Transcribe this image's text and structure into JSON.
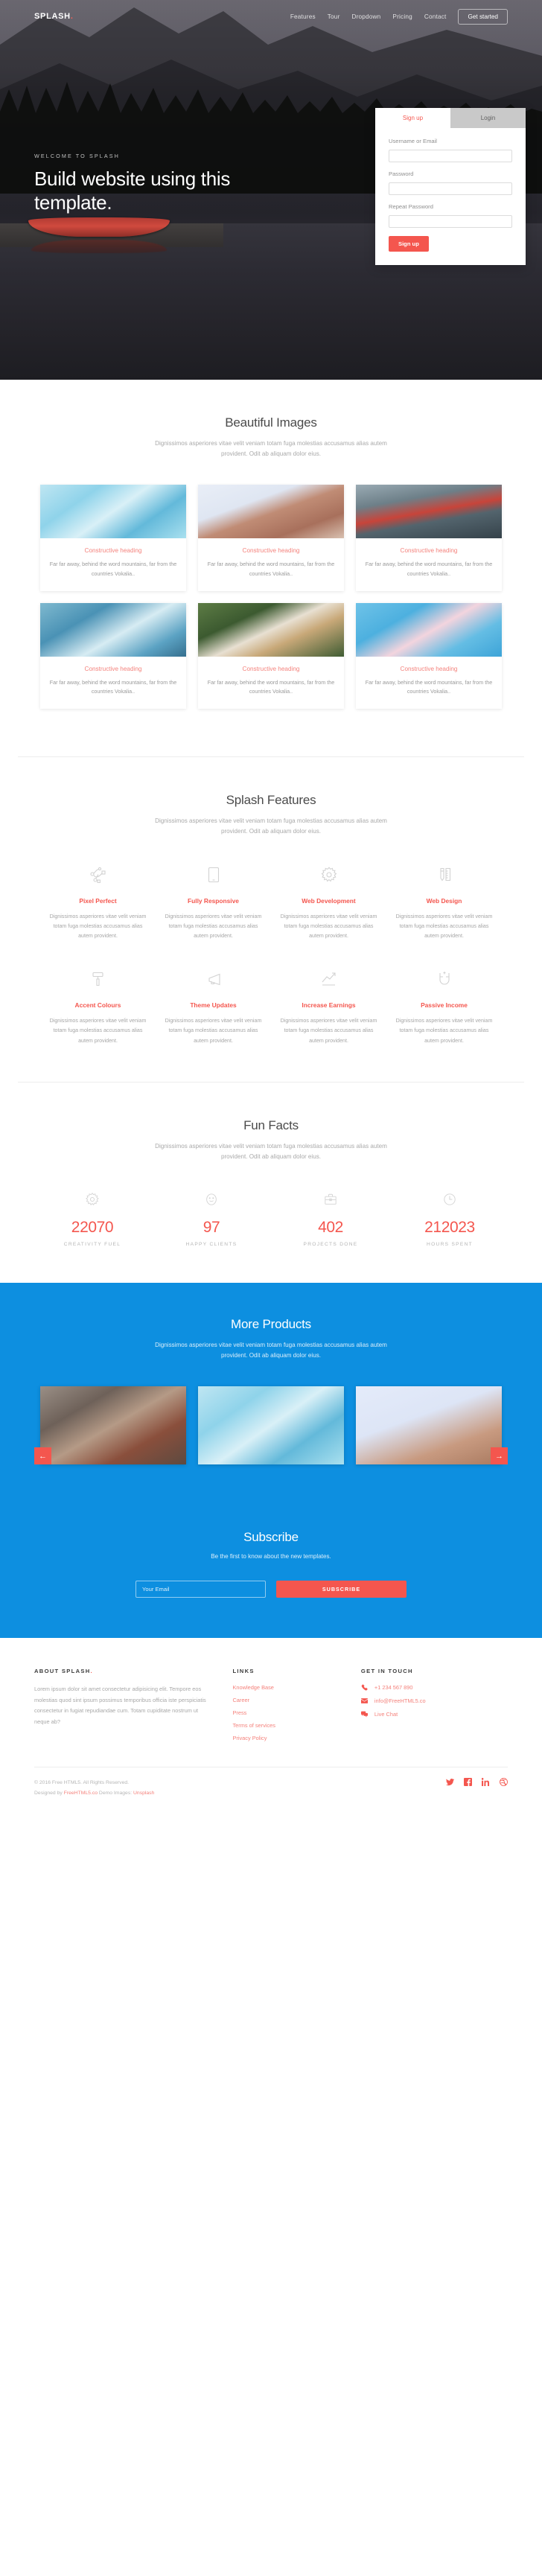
{
  "nav": {
    "brand": "SPLASH",
    "brand_dot": ".",
    "links": [
      {
        "label": "Features"
      },
      {
        "label": "Tour"
      },
      {
        "label": "Dropdown"
      },
      {
        "label": "Pricing"
      },
      {
        "label": "Contact"
      }
    ],
    "cta": "Get started"
  },
  "hero": {
    "eyebrow": "WELCOME TO SPLASH",
    "title": "Build website using this template."
  },
  "signup": {
    "tab_signup": "Sign up",
    "tab_login": "Login",
    "label_username": "Username or Email",
    "label_password": "Password",
    "label_repeat": "Repeat Password",
    "value_username": "",
    "value_password": "",
    "value_repeat": "",
    "button": "Sign up"
  },
  "images_section": {
    "title": "Beautiful Images",
    "subtitle": "Dignissimos asperiores vitae velit veniam totam fuga molestias accusamus alias autem provident. Odit ab aliquam dolor eius.",
    "cards": [
      {
        "heading": "Constructive heading",
        "text": "Far far away, behind the word mountains, far from the countries Vokalia..",
        "photo": "ph-swim"
      },
      {
        "heading": "Constructive heading",
        "text": "Far far away, behind the word mountains, far from the countries Vokalia..",
        "photo": "ph-bldg"
      },
      {
        "heading": "Constructive heading",
        "text": "Far far away, behind the word mountains, far from the countries Vokalia..",
        "photo": "ph-canoe"
      },
      {
        "heading": "Constructive heading",
        "text": "Far far away, behind the word mountains, far from the countries Vokalia..",
        "photo": "ph-water"
      },
      {
        "heading": "Constructive heading",
        "text": "Far far away, behind the word mountains, far from the countries Vokalia..",
        "photo": "ph-flow"
      },
      {
        "heading": "Constructive heading",
        "text": "Far far away, behind the word mountains, far from the countries Vokalia..",
        "photo": "ph-blos"
      }
    ]
  },
  "features_section": {
    "title": "Splash Features",
    "subtitle": "Dignissimos asperiores vitae velit veniam totam fuga molestias accusamus alias autem provident. Odit ab aliquam dolor eius.",
    "items": [
      {
        "icon": "node-graph-icon",
        "title": "Pixel Perfect",
        "text": "Dignissimos asperiores vitae velit veniam totam fuga molestias accusamus alias autem provident."
      },
      {
        "icon": "tablet-icon",
        "title": "Fully Responsive",
        "text": "Dignissimos asperiores vitae velit veniam totam fuga molestias accusamus alias autem provident."
      },
      {
        "icon": "gear-icon",
        "title": "Web Development",
        "text": "Dignissimos asperiores vitae velit veniam totam fuga molestias accusamus alias autem provident."
      },
      {
        "icon": "pencil-ruler-icon",
        "title": "Web Design",
        "text": "Dignissimos asperiores vitae velit veniam totam fuga molestias accusamus alias autem provident."
      },
      {
        "icon": "paint-roller-icon",
        "title": "Accent Colours",
        "text": "Dignissimos asperiores vitae velit veniam totam fuga molestias accusamus alias autem provident."
      },
      {
        "icon": "megaphone-icon",
        "title": "Theme Updates",
        "text": "Dignissimos asperiores vitae velit veniam totam fuga molestias accusamus alias autem provident."
      },
      {
        "icon": "trend-up-icon",
        "title": "Increase Earnings",
        "text": "Dignissimos asperiores vitae velit veniam totam fuga molestias accusamus alias autem provident."
      },
      {
        "icon": "magnet-icon",
        "title": "Passive Income",
        "text": "Dignissimos asperiores vitae velit veniam totam fuga molestias accusamus alias autem provident."
      }
    ]
  },
  "facts_section": {
    "title": "Fun Facts",
    "subtitle": "Dignissimos asperiores vitae velit veniam totam fuga molestias accusamus alias autem provident. Odit ab aliquam dolor eius.",
    "items": [
      {
        "icon": "gear-icon",
        "number": "22070",
        "label": "CREATIVITY FUEL"
      },
      {
        "icon": "smiley-icon",
        "number": "97",
        "label": "HAPPY CLIENTS"
      },
      {
        "icon": "briefcase-icon",
        "number": "402",
        "label": "PROJECTS DONE"
      },
      {
        "icon": "clock-icon",
        "number": "212023",
        "label": "HOURS SPENT"
      }
    ]
  },
  "products_section": {
    "title": "More Products",
    "subtitle": "Dignissimos asperiores vitae velit veniam totam fuga molestias accusamus alias autem provident. Odit ab aliquam dolor eius.",
    "slides": [
      {
        "photo": "ph-rock"
      },
      {
        "photo": "ph-swim"
      },
      {
        "photo": "ph-light"
      }
    ],
    "prev": "←",
    "next": "→"
  },
  "subscribe_section": {
    "title": "Subscribe",
    "lead": "Be the first to know about the new templates.",
    "placeholder": "Your Email",
    "value": "",
    "button": "SUBSCRIBE"
  },
  "footer": {
    "about_head": "ABOUT SPLASH",
    "about_dot": ".",
    "about_text": "Lorem ipsum dolor sit amet consectetur adipisicing elit. Tempore eos molestias quod sint ipsum possimus temporibus officia iste perspiciatis consectetur in fugiat repudiandae cum. Totam cupiditate nostrum ut neque ab?",
    "links_head": "LINKS",
    "links": [
      {
        "label": "Knowledge Base"
      },
      {
        "label": "Career"
      },
      {
        "label": "Press"
      },
      {
        "label": "Terms of services"
      },
      {
        "label": "Privacy Policy"
      }
    ],
    "touch_head": "GET IN TOUCH",
    "touch": [
      {
        "icon": "phone-icon",
        "label": "+1 234 567 890"
      },
      {
        "icon": "envelope-icon",
        "label": "info@FreeHTML5.co"
      },
      {
        "icon": "chat-icon",
        "label": "Live Chat"
      }
    ],
    "copyright": "© 2016 Free HTML5. All Rights Reserved.",
    "designed_prefix": "Designed by ",
    "designed_link": "FreeHTML5.co",
    "demo_prefix": " Demo Images: ",
    "demo_link": "Unsplash",
    "socials": [
      {
        "icon": "twitter-icon",
        "glyph": "𝐭"
      },
      {
        "icon": "facebook-icon",
        "glyph": "f"
      },
      {
        "icon": "linkedin-icon",
        "glyph": "in"
      },
      {
        "icon": "dribbble-icon",
        "glyph": "◌"
      }
    ]
  },
  "colors": {
    "accent_red": "#f4564e",
    "accent_blue": "#0d8fe0",
    "muted": "#a9a9a9"
  }
}
